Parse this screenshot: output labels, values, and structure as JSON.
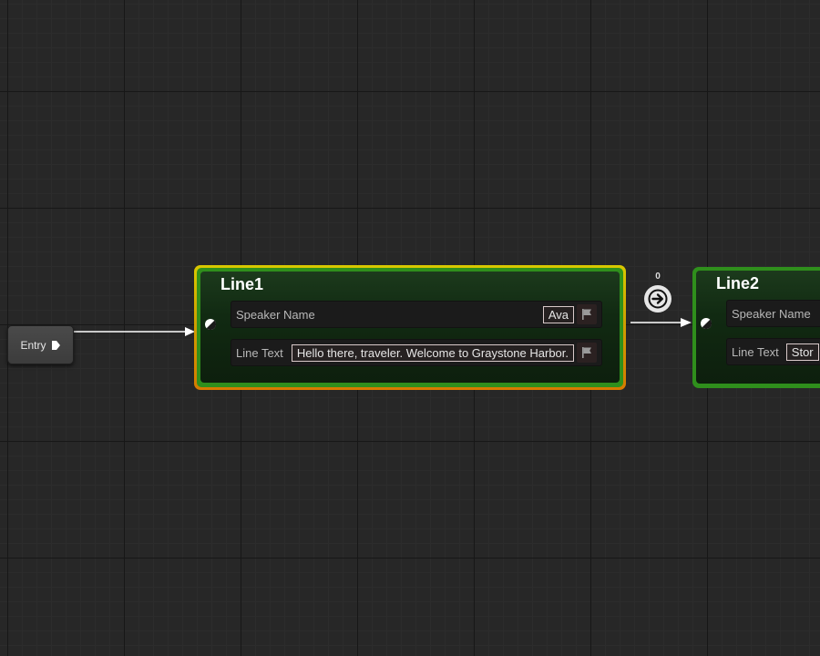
{
  "graph": {
    "entry_node": {
      "label": "Entry",
      "exec_icon": "exec-pin-icon"
    },
    "nodes": [
      {
        "title": "Line1",
        "selected": true,
        "speaker_label": "Speaker Name",
        "speaker_value": "Ava",
        "line_label": "Line Text",
        "line_value": "Hello there, traveler. Welcome to Graystone Harbor.",
        "flag_icon": "localization-flag-icon"
      },
      {
        "title": "Line2",
        "selected": false,
        "speaker_label": "Speaker Name",
        "speaker_value": "",
        "line_label": "Line Text",
        "line_value": "Stor",
        "flag_icon": "localization-flag-icon"
      }
    ],
    "transition": {
      "count": "0",
      "icon": "arrow-right-icon"
    },
    "colors": {
      "background": "#272727",
      "node_border": "#2f8f1c",
      "selection_outline": "#d8b000",
      "wire": "#ffffff"
    }
  }
}
